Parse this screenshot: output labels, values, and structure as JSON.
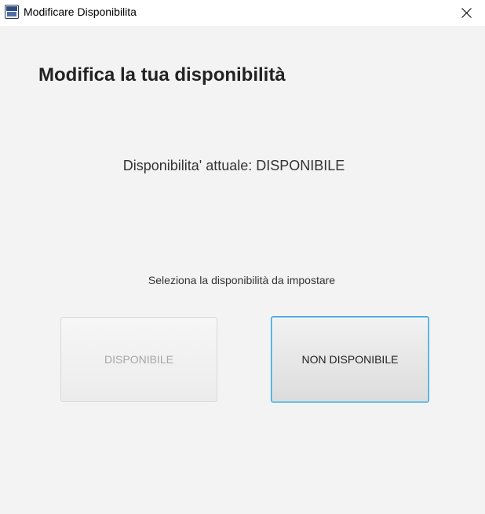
{
  "window": {
    "title": "Modificare Disponibilita",
    "app_icon": "app-logo-icon",
    "close_icon": "close-icon"
  },
  "main": {
    "heading": "Modifica la tua disponibilità",
    "current_status": "Disponibilita' attuale: DISPONIBILE",
    "instruction": "Seleziona la disponibilità da impostare",
    "buttons": {
      "available": {
        "label": "DISPONIBILE",
        "enabled": false
      },
      "unavailable": {
        "label": "NON DISPONIBILE",
        "enabled": true,
        "focused": true
      }
    }
  },
  "colors": {
    "background": "#f3f3f3",
    "titlebar": "#ffffff",
    "focus_border": "#2a9fd6",
    "disabled_text": "#a6a6a6"
  }
}
